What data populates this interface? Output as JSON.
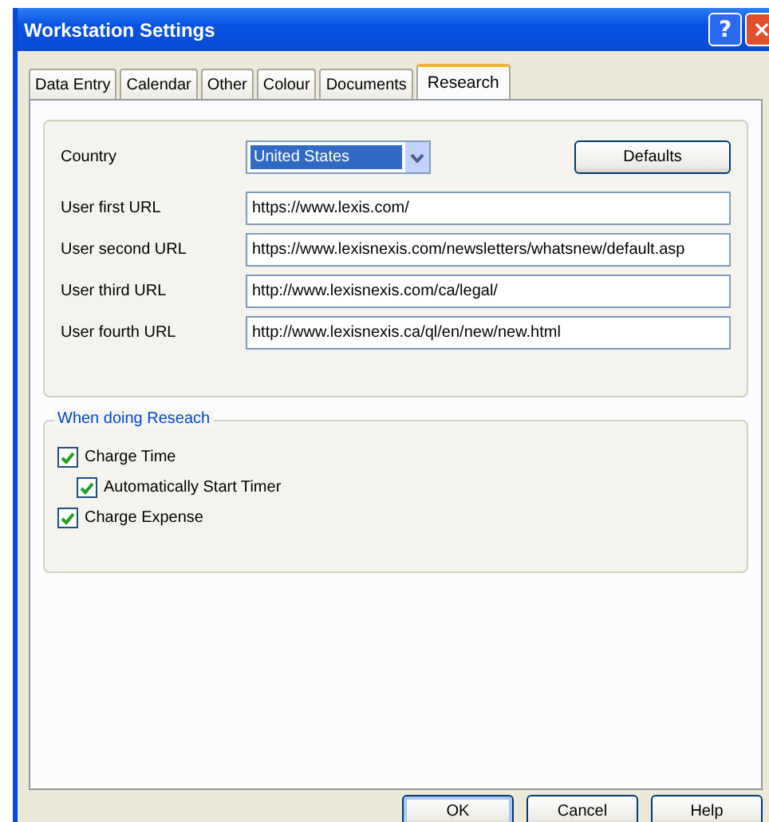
{
  "window": {
    "title": "Workstation Settings",
    "title_buttons": [
      "?",
      "×"
    ]
  },
  "tabs": [
    {
      "label": "Data Entry",
      "selected": false
    },
    {
      "label": "Calendar",
      "selected": false
    },
    {
      "label": "Other",
      "selected": false
    },
    {
      "label": "Colour",
      "selected": false
    },
    {
      "label": "Documents",
      "selected": false
    },
    {
      "label": "Research",
      "selected": true
    }
  ],
  "country": {
    "label": "Country",
    "value": "United States"
  },
  "defaults_button": "Defaults",
  "urls": [
    {
      "label": "User first URL",
      "value": "https://www.lexis.com/"
    },
    {
      "label": "User second URL",
      "value": "https://www.lexisnexis.com/newsletters/whatsnew/default.asp"
    },
    {
      "label": "User third URL",
      "value": "http://www.lexisnexis.com/ca/legal/"
    },
    {
      "label": "User fourth URL",
      "value": "http://www.lexisnexis.ca/ql/en/new/new.html"
    }
  ],
  "research_group": {
    "title": "When doing Reseach",
    "options": [
      {
        "label": "Charge Time",
        "checked": true,
        "children": [
          {
            "label": "Automatically Start Timer",
            "checked": true
          }
        ]
      },
      {
        "label": "Charge Expense",
        "checked": true
      }
    ]
  },
  "buttons": [
    "OK",
    "Cancel",
    "Help"
  ]
}
